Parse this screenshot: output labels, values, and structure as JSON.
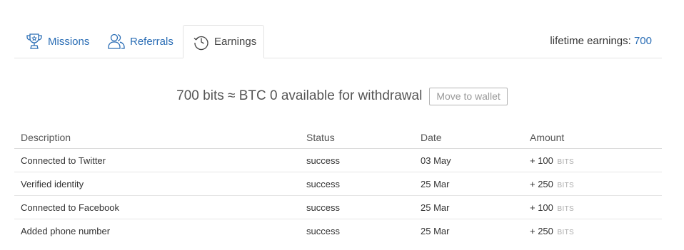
{
  "tabs": [
    {
      "label": "Missions",
      "icon": "trophy-icon"
    },
    {
      "label": "Referrals",
      "icon": "users-icon"
    },
    {
      "label": "Earnings",
      "icon": "history-icon"
    }
  ],
  "active_tab": "Earnings",
  "lifetime": {
    "label": "lifetime earnings:",
    "value": "700"
  },
  "summary": {
    "text": "700 bits ≈ BTC 0 available for withdrawal",
    "button_label": "Move to wallet"
  },
  "table": {
    "headers": [
      "Description",
      "Status",
      "Date",
      "Amount"
    ],
    "rows": [
      {
        "description": "Connected to Twitter",
        "status": "success",
        "date": "03 May",
        "amount": "+ 100",
        "unit": "BITS"
      },
      {
        "description": "Verified identity",
        "status": "success",
        "date": "25 Mar",
        "amount": "+ 250",
        "unit": "BITS"
      },
      {
        "description": "Connected to Facebook",
        "status": "success",
        "date": "25 Mar",
        "amount": "+ 100",
        "unit": "BITS"
      },
      {
        "description": "Added phone number",
        "status": "success",
        "date": "25 Mar",
        "amount": "+ 250",
        "unit": "BITS"
      }
    ]
  },
  "colors": {
    "link": "#2a6db5",
    "text": "#333333",
    "muted": "#aaaaaa",
    "border": "#e3e3e3"
  }
}
